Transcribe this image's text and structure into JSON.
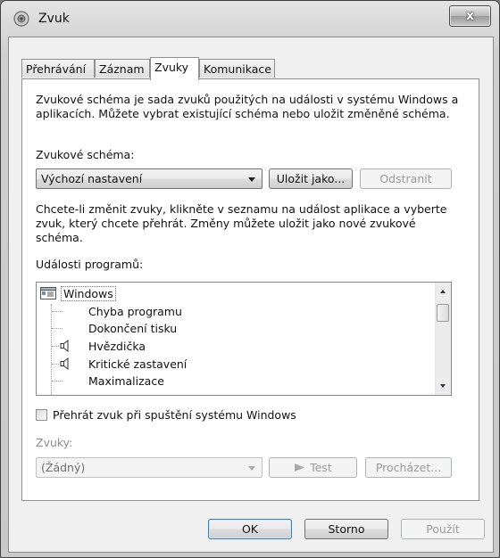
{
  "window": {
    "title": "Zvuk",
    "close_glyph": "x"
  },
  "tabs": [
    {
      "label": "Přehrávání"
    },
    {
      "label": "Záznam"
    },
    {
      "label": "Zvuky"
    },
    {
      "label": "Komunikace"
    }
  ],
  "active_tab": "Zvuky",
  "intro_text": "Zvukové schéma je sada zvuků použitých na události v systému Windows a aplikacích. Můžete vybrat existující schéma nebo uložit změněné schéma.",
  "scheme": {
    "label": "Zvukové schéma:",
    "selected": "Výchozí nastavení",
    "save_as_button": "Uložit jako...",
    "remove_button": "Odstranit"
  },
  "instructions_text": "Chcete-li změnit zvuky, klikněte v seznamu na událost aplikace a vyberte zvuk, který chcete přehrát. Změny můžete uložit jako nové zvukové schéma.",
  "events": {
    "label": "Události programů:",
    "root": "Windows",
    "items": [
      {
        "label": "Chyba programu",
        "has_sound": false
      },
      {
        "label": "Dokončení tisku",
        "has_sound": false
      },
      {
        "label": "Hvězdička",
        "has_sound": true
      },
      {
        "label": "Kritické zastavení",
        "has_sound": true
      },
      {
        "label": "Maximalizace",
        "has_sound": false
      }
    ]
  },
  "startup_checkbox": {
    "label": "Přehrát zvuk při spuštění systému Windows",
    "checked": false
  },
  "sounds": {
    "label": "Zvuky:",
    "selected": "(Žádný)",
    "test_button": "Test",
    "browse_button": "Procházet..."
  },
  "footer": {
    "ok": "OK",
    "cancel": "Storno",
    "apply": "Použít"
  }
}
